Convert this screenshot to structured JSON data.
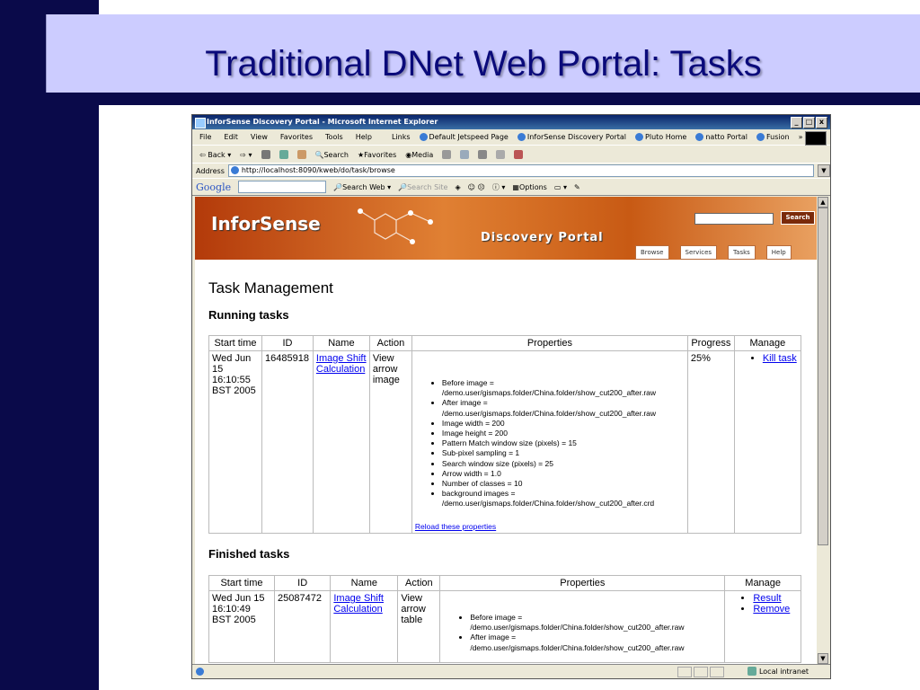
{
  "slide": {
    "title": "Traditional DNet Web Portal: Tasks"
  },
  "browser": {
    "window_title": "InforSense Discovery Portal - Microsoft Internet Explorer",
    "window_buttons": [
      "_",
      "□",
      "x"
    ],
    "menu": [
      "File",
      "Edit",
      "View",
      "Favorites",
      "Tools",
      "Help"
    ],
    "links_label": "Links",
    "links": [
      "Default Jetspeed Page",
      "InforSense Discovery Portal",
      "Pluto Home",
      "natto Portal",
      "Fusion"
    ],
    "links_more": "»",
    "toolbar": {
      "back": "Back",
      "search": "Search",
      "favorites": "Favorites",
      "media": "Media"
    },
    "address_label": "Address",
    "address_url": "http://localhost:8090/kweb/do/task/browse",
    "google": {
      "logo": "Google",
      "search_web": "Search Web",
      "search_site": "Search Site",
      "options": "Options"
    },
    "status": {
      "zone": "Local intranet"
    }
  },
  "portal": {
    "logo": "InforSense",
    "portal_name": "Discovery Portal",
    "search_button": "Search",
    "nav": [
      "Browse",
      "Services",
      "Tasks",
      "Help"
    ]
  },
  "page": {
    "heading": "Task Management",
    "running_heading": "Running tasks",
    "finished_heading": "Finished tasks",
    "running_headers": [
      "Start time",
      "ID",
      "Name",
      "Action",
      "Properties",
      "Progress",
      "Manage"
    ],
    "finished_headers": [
      "Start time",
      "ID",
      "Name",
      "Action",
      "Properties",
      "Manage"
    ],
    "running_row": {
      "start_time": "Wed Jun 15 16:10:55 BST 2005",
      "id": "16485918",
      "name": "Image Shift Calculation",
      "action": "View arrow image",
      "properties": [
        "Before image = /demo.user/gismaps.folder/China.folder/show_cut200_after.raw",
        "After image = /demo.user/gismaps.folder/China.folder/show_cut200_after.raw",
        "Image width = 200",
        "Image height = 200",
        "Pattern Match window size (pixels) = 15",
        "Sub-pixel sampling = 1",
        "Search window size (pixels) = 25",
        "Arrow width = 1.0",
        "Number of classes = 10",
        "background images = /demo.user/gismaps.folder/China.folder/show_cut200_after.crd"
      ],
      "reload": "Reload these properties",
      "progress": "25%",
      "manage": [
        "Kill task"
      ]
    },
    "finished_row": {
      "start_time": "Wed Jun 15 16:10:49 BST 2005",
      "id": "25087472",
      "name": "Image Shift Calculation",
      "action": "View arrow table",
      "properties": [
        "Before image = /demo.user/gismaps.folder/China.folder/show_cut200_after.raw",
        "After image = /demo.user/gismaps.folder/China.folder/show_cut200_after.raw"
      ],
      "manage": [
        "Result",
        "Remove"
      ]
    }
  }
}
